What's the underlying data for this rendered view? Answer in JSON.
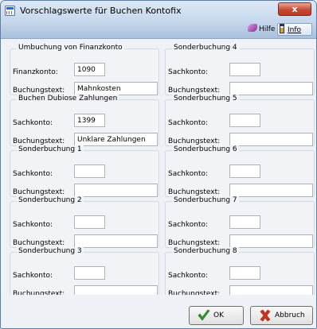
{
  "window": {
    "title": "Vorschlagswerte für Buchen Kontofix",
    "close_label": "x"
  },
  "toolbar": {
    "help_label": "Hilfe",
    "info_label": "Info"
  },
  "groups": [
    {
      "title": "Umbuchung von Finanzkonto",
      "label1": "Finanzkonto:",
      "value1": "1090",
      "label2": "Buchungstext:",
      "value2": "Mahnkosten"
    },
    {
      "title": "Sonderbuchung 4",
      "label1": "Sachkonto:",
      "value1": "",
      "label2": "Buchungstext:",
      "value2": ""
    },
    {
      "title": "Buchen Dubiose Zahlungen",
      "label1": "Sachkonto:",
      "value1": "1399",
      "label2": "Buchungstext:",
      "value2": "Unklare Zahlungen"
    },
    {
      "title": "Sonderbuchung 5",
      "label1": "Sachkonto:",
      "value1": "",
      "label2": "Buchungstext:",
      "value2": ""
    },
    {
      "title": "Sonderbuchung 1",
      "label1": "Sachkonto:",
      "value1": "",
      "label2": "Buchungstext:",
      "value2": ""
    },
    {
      "title": "Sonderbuchung 6",
      "label1": "Sachkonto:",
      "value1": "",
      "label2": "Buchungstext:",
      "value2": ""
    },
    {
      "title": "Sonderbuchung 2",
      "label1": "Sachkonto:",
      "value1": "",
      "label2": "Buchungstext:",
      "value2": ""
    },
    {
      "title": "Sonderbuchung 7",
      "label1": "Sachkonto:",
      "value1": "",
      "label2": "Buchungstext:",
      "value2": ""
    },
    {
      "title": "Sonderbuchung 3",
      "label1": "Sachkonto:",
      "value1": "",
      "label2": "Buchungstext:",
      "value2": ""
    },
    {
      "title": "Sonderbuchung 8",
      "label1": "Sachkonto:",
      "value1": "",
      "label2": "Buchungstext:",
      "value2": ""
    }
  ],
  "buttons": {
    "ok_label": "OK",
    "cancel_label": "Abbruch"
  },
  "icons": {
    "help": "help-icon",
    "info": "info-icon",
    "ok": "check-icon",
    "cancel": "x-icon"
  },
  "colors": {
    "titlebar": "#c6d7ec",
    "toolbar": "#a9c0dc",
    "close": "#c74b33",
    "ok_check": "#2e9a2e",
    "cancel_x": "#cc3322"
  }
}
